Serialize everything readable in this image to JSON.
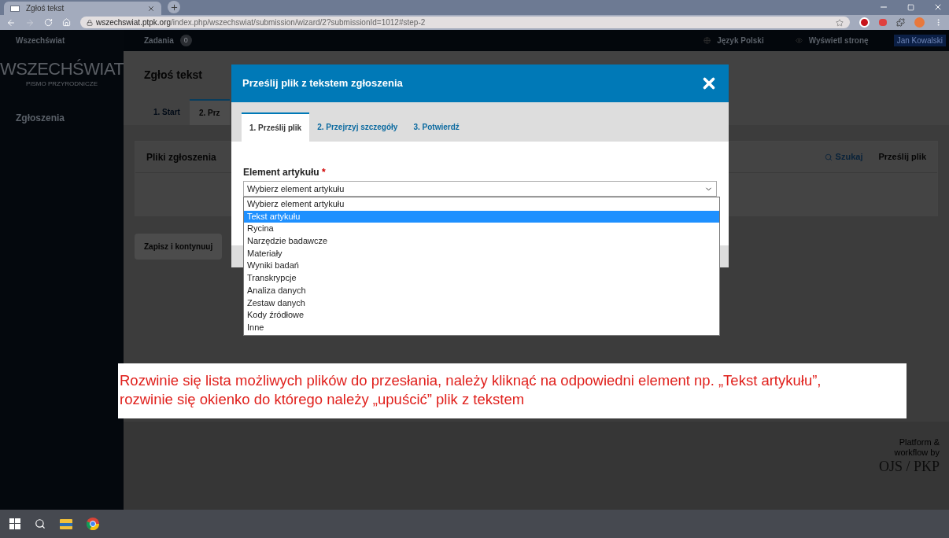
{
  "browser": {
    "tab_title": "Zgłoś tekst",
    "url_host": "wszechswiat.ptpk.org",
    "url_path": "/index.php/wszechswiat/submission/wizard/2?submissionId=1012#step-2"
  },
  "top_bar": {
    "site": "Wszechświat",
    "tasks": "Zadania",
    "tasks_count": "0",
    "language": "Język Polski",
    "view_site": "Wyświetl stronę",
    "user": "Jan Kowalski"
  },
  "sidebar": {
    "logo": "WSZECHŚWIAT",
    "logo_subtitle": "PISMO PRZYRODNICZE",
    "items": [
      {
        "label": "Zgłoszenia"
      }
    ]
  },
  "main": {
    "title": "Zgłoś tekst",
    "steps": [
      {
        "label": "1. Start",
        "selected": false
      },
      {
        "label": "2. Prz",
        "selected": true
      }
    ],
    "panel_title": "Pliki zgłoszenia",
    "search": "Szukaj",
    "upload": "Prześlij plik",
    "save_button": "Zapisz i kontynuuj"
  },
  "modal": {
    "title": "Prześlij plik z tekstem zgłoszenia",
    "tabs": [
      {
        "label": "1. Prześlij plik",
        "selected": true
      },
      {
        "label": "2. Przejrzyj szczegóły",
        "selected": false
      },
      {
        "label": "3. Potwierdź",
        "selected": false
      }
    ],
    "field_label": "Element artykułu",
    "required_mark": "*",
    "select_value": "Wybierz element artykułu",
    "options": [
      {
        "label": "Wybierz element artykułu",
        "selected": false
      },
      {
        "label": "Tekst artykułu",
        "selected": true
      },
      {
        "label": "Rycina",
        "selected": false
      },
      {
        "label": "Narzędzie badawcze",
        "selected": false
      },
      {
        "label": "Materiały",
        "selected": false
      },
      {
        "label": "Wyniki badań",
        "selected": false
      },
      {
        "label": "Transkrypcje",
        "selected": false
      },
      {
        "label": "Analiza danych",
        "selected": false
      },
      {
        "label": "Zestaw danych",
        "selected": false
      },
      {
        "label": "Kody źródłowe",
        "selected": false
      },
      {
        "label": "Inne",
        "selected": false
      }
    ]
  },
  "annotation": {
    "lines": [
      "Rozwinie się lista możliwych plików do przesłania, należy kliknąć na odpowiedni element np. „Tekst artykułu”,",
      "rozwinie się okienko do którego należy „upuścić” plik z tekstem"
    ]
  },
  "footer": {
    "line1": "Platform &",
    "line2": "workflow by",
    "logo": "OJS / PKP"
  }
}
